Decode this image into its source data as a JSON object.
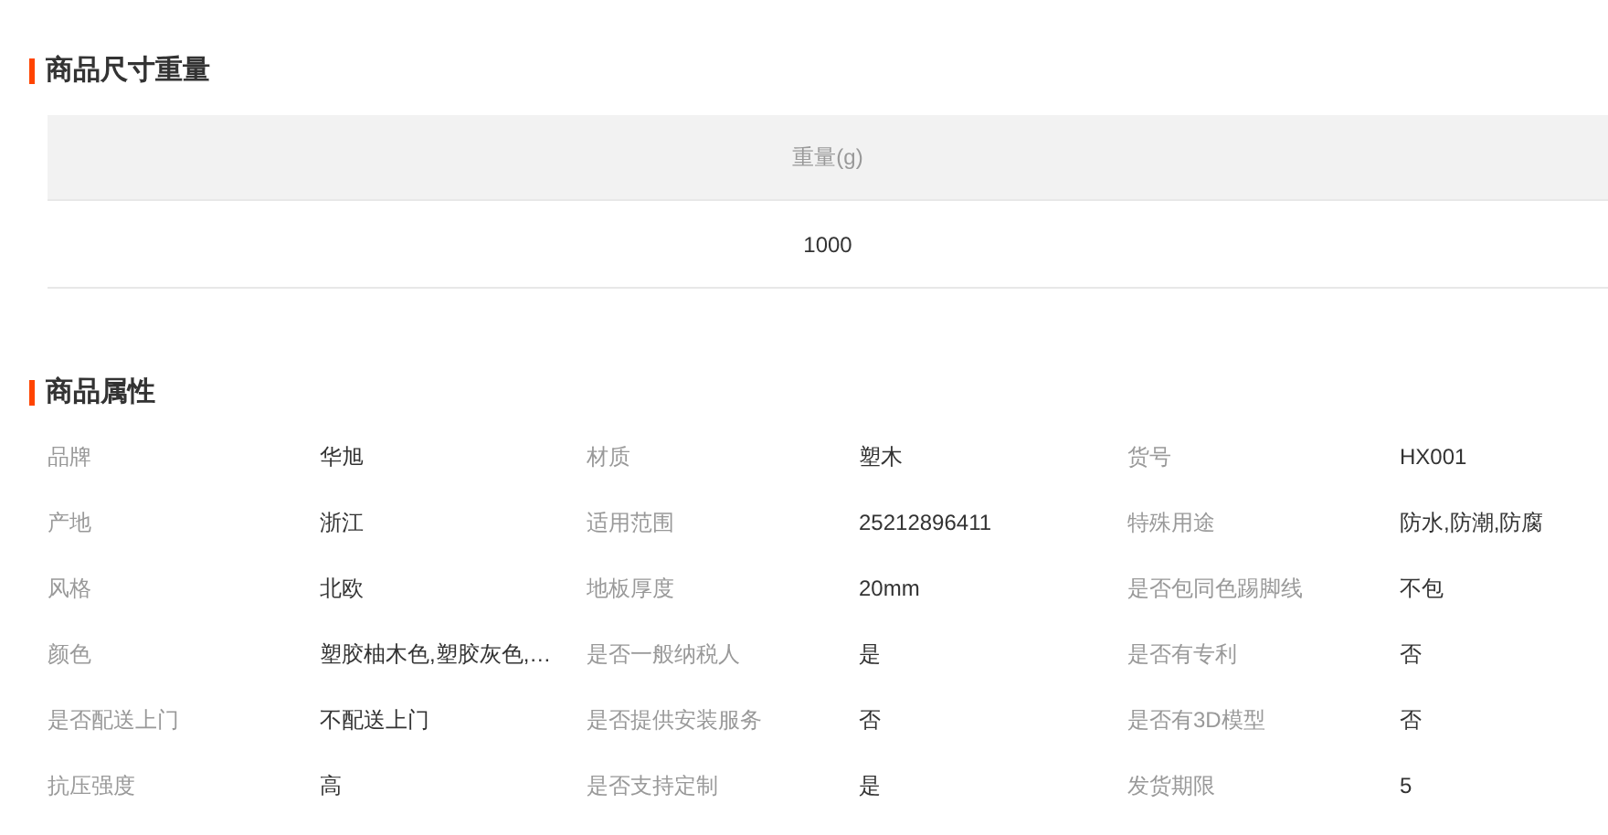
{
  "size_section": {
    "title": "商品尺寸重量",
    "table": {
      "columns": [
        "重量(g)"
      ],
      "rows": [
        [
          "1000"
        ]
      ]
    }
  },
  "attributes_section": {
    "title": "商品属性",
    "attributes": [
      {
        "label": "品牌",
        "value": "华旭"
      },
      {
        "label": "材质",
        "value": "塑木"
      },
      {
        "label": "货号",
        "value": "HX001"
      },
      {
        "label": "产地",
        "value": "浙江"
      },
      {
        "label": "适用范围",
        "value": "25212896411"
      },
      {
        "label": "特殊用途",
        "value": "防水,防潮,防腐"
      },
      {
        "label": "风格",
        "value": "北欧"
      },
      {
        "label": "地板厚度",
        "value": "20mm"
      },
      {
        "label": "是否包同色踢脚线",
        "value": "不包"
      },
      {
        "label": "颜色",
        "value": "塑胶柚木色,塑胶灰色,…"
      },
      {
        "label": "是否一般纳税人",
        "value": "是"
      },
      {
        "label": "是否有专利",
        "value": "否"
      },
      {
        "label": "是否配送上门",
        "value": "不配送上门"
      },
      {
        "label": "是否提供安装服务",
        "value": "否"
      },
      {
        "label": "是否有3D模型",
        "value": "否"
      },
      {
        "label": "抗压强度",
        "value": "高"
      },
      {
        "label": "是否支持定制",
        "value": "是"
      },
      {
        "label": "发货期限",
        "value": "5"
      }
    ]
  }
}
